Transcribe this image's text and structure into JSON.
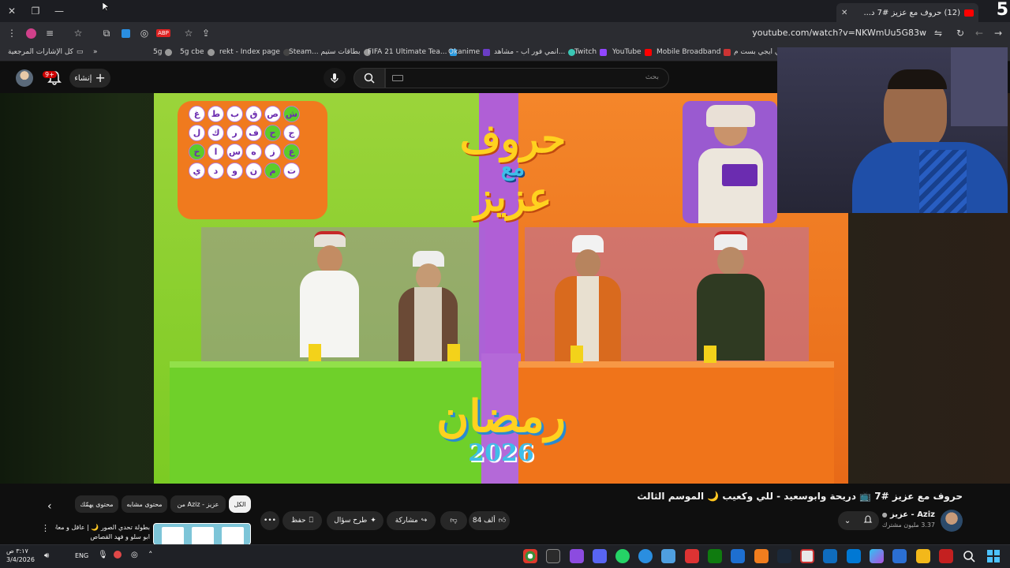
{
  "browser": {
    "tab_title": "(12) حروف مع عزيز #7 د...",
    "corner_number": "5",
    "url": "youtube.com/watch?v=NKWmUu5G83w",
    "bookmarks": [
      {
        "label": "كل الإشارات المرجعية"
      },
      {
        "label": "5g"
      },
      {
        "label": "5g cbe"
      },
      {
        "label": "rekt - Index page"
      },
      {
        "label": "Steam... بطاقات ستيم"
      },
      {
        "label": "FIFA 21 Ultimate Tea..."
      },
      {
        "label": "Okanime"
      },
      {
        "label": "انمي فور اب - مشاهد..."
      },
      {
        "label": "Twitch"
      },
      {
        "label": "YouTube"
      },
      {
        "label": "Mobile Broadband"
      },
      {
        "label": "لي ايجي بست م..."
      }
    ],
    "bookmarks_overflow": "»"
  },
  "youtube": {
    "search_placeholder": "بحث",
    "create_label": "إنشاء",
    "notification_count": "9+",
    "video": {
      "title": "حروف مع عزيز #7 📺 دريحة وابوسعيد - للي وكعيب 🌙 الموسم الثالث",
      "channel_name": "Aziz - عزيز",
      "channel_subs": "3.37 مليون مشترك",
      "likes": "84 ألف",
      "share_label": "مشاركة",
      "ask_label": "طرح سؤال",
      "save_label": "حفظ",
      "more_label": "•••",
      "overlay": {
        "show_title_line1": "حروف",
        "show_title_line2": "مع",
        "show_title_line3": "عزيز",
        "season_word": "رمضان",
        "year": "2026",
        "letters": [
          "غ",
          "ط",
          "ب",
          "ق",
          "ص",
          "ش",
          "ل",
          "ك",
          "ر",
          "ف",
          "ح",
          "ج",
          "خ",
          "ا",
          "س",
          "ه",
          "ز",
          "ع",
          "ي",
          "د",
          "و",
          "ن",
          "م",
          "ت"
        ]
      }
    },
    "chips": [
      {
        "label": "الكل",
        "selected": true
      },
      {
        "label": "من Aziz - عزيز",
        "selected": false
      },
      {
        "label": "محتوى مشابه",
        "selected": false
      },
      {
        "label": "محتوى يهمّك",
        "selected": false
      }
    ],
    "related": {
      "title_line1": "بطولة تحدي الصور 🌙 | عاقل و معاذ ضد",
      "title_line2": "ابو سلو و فهد القصاص"
    }
  },
  "taskbar": {
    "time": "٣:١٧ ص",
    "date": "3/4/2026",
    "lang": "ENG"
  },
  "colors": {
    "yt_red": "#ff0000",
    "green_set": "#8ad32a",
    "orange_set": "#f07a1e",
    "purple_set": "#a86ad4"
  }
}
